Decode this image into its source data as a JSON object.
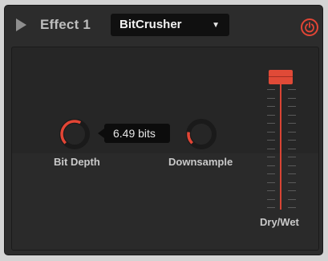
{
  "header": {
    "title": "Effect 1",
    "effect_select": {
      "value": "BitCrusher"
    }
  },
  "controls": {
    "bit_depth": {
      "label": "Bit Depth",
      "tooltip": "6.49 bits",
      "level": 0.6
    },
    "downsample": {
      "label": "Downsample",
      "level": 0.2
    },
    "dry_wet": {
      "label": "Dry/Wet",
      "level": 1.0
    }
  },
  "colors": {
    "accent": "#e24535",
    "panel_bg": "#262626",
    "frame_bg": "#2c2c2c",
    "text": "#c9c9c9"
  },
  "icons": {
    "play": "play-icon",
    "power": "power-icon",
    "dropdown": "chevron-down-icon"
  }
}
